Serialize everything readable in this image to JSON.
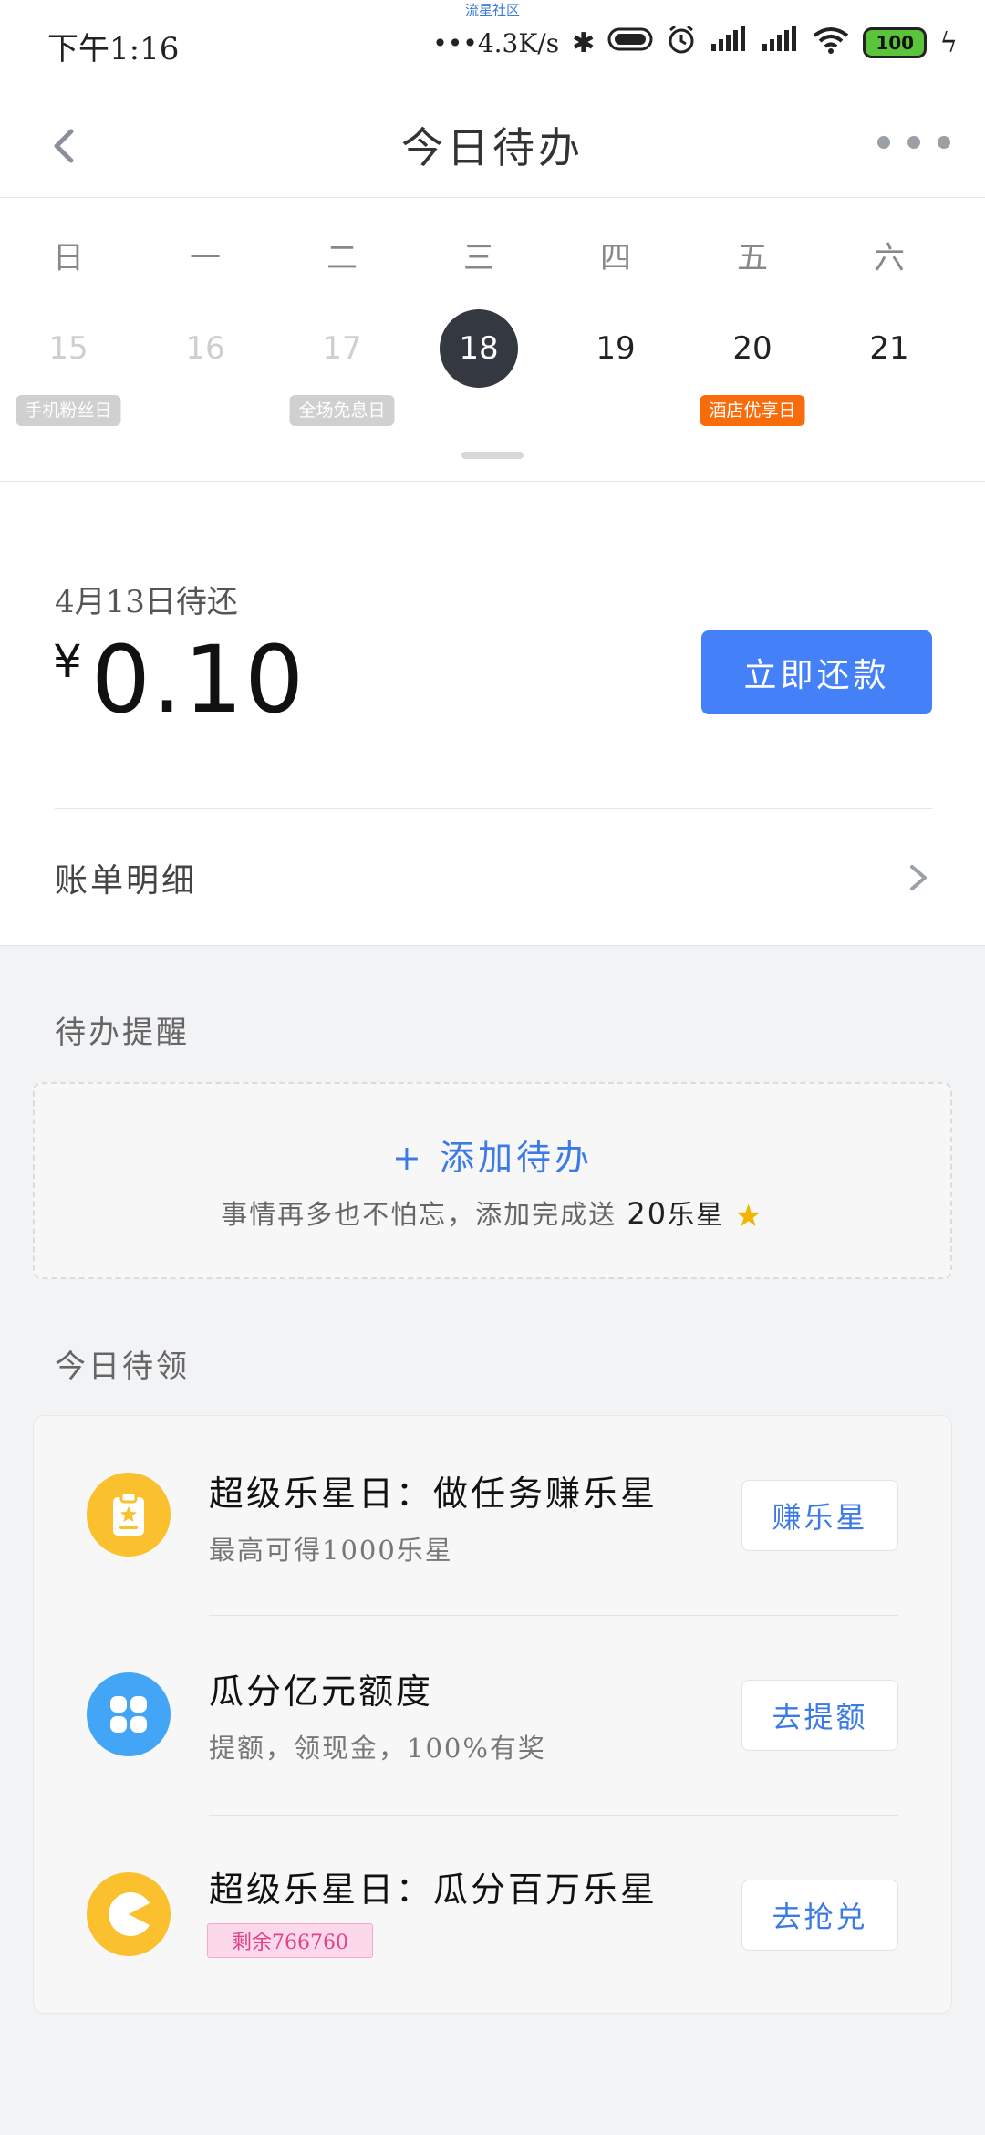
{
  "status_bar": {
    "watermark": "流星社区",
    "time": "下午1:16",
    "speed": "•••4.3K/s",
    "battery": "100"
  },
  "header": {
    "title": "今日待办"
  },
  "calendar": {
    "weekdays": [
      "日",
      "一",
      "二",
      "三",
      "四",
      "五",
      "六"
    ],
    "dates": [
      "15",
      "16",
      "17",
      "18",
      "19",
      "20",
      "21"
    ],
    "tags": {
      "15": "手机粉丝日",
      "17": "全场免息日",
      "20": "酒店优享日"
    }
  },
  "bill": {
    "due_label": "4月13日待还",
    "currency": "¥",
    "amount": "0.10",
    "pay_button": "立即还款",
    "detail_label": "账单明细"
  },
  "reminders": {
    "section_title": "待办提醒",
    "add_label": "+ 添加待办",
    "add_sub_prefix": "事情再多也不怕忘，添加完成送",
    "add_sub_reward": "20",
    "add_sub_suffix": "乐星"
  },
  "today": {
    "section_title": "今日待领",
    "items": [
      {
        "title": "超级乐星日：做任务赚乐星",
        "subtitle": "最高可得1000乐星",
        "button": "赚乐星",
        "icon": "clipboard-star-icon"
      },
      {
        "title": "瓜分亿元额度",
        "subtitle": "提额，领现金，100%有奖",
        "button": "去提额",
        "icon": "clover-icon"
      },
      {
        "title": "超级乐星日：瓜分百万乐星",
        "badge": "剩余766760",
        "button": "去抢兑",
        "icon": "pacman-star-icon"
      }
    ]
  },
  "colors": {
    "accent": "#4480f7",
    "link": "#3c7ae6",
    "today_circle": "#333841",
    "tag_orange": "#f96c0c",
    "icon_yellow": "#fbc02d",
    "icon_blue": "#42a5f5"
  }
}
